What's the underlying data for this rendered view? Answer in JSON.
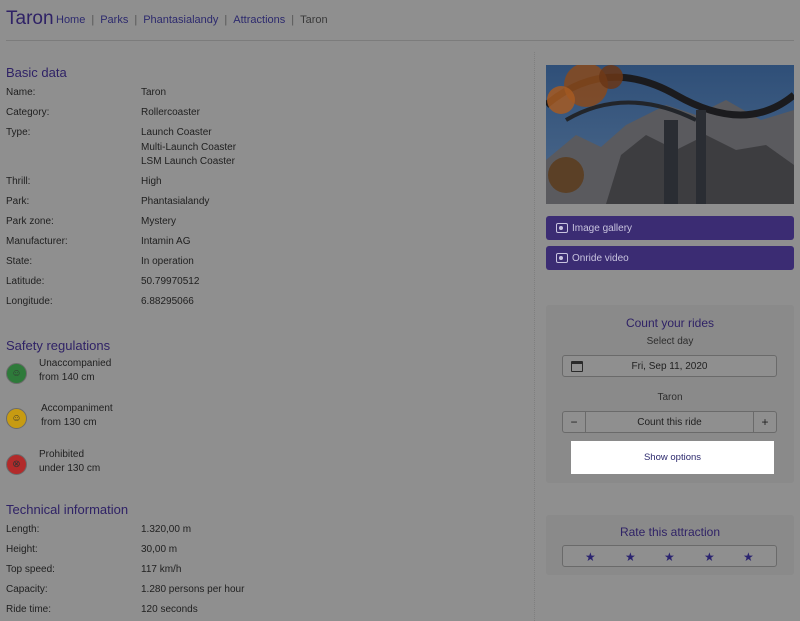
{
  "page": {
    "title": "Taron",
    "breadcrumbs": [
      "Home",
      "Parks",
      "Phantasialandy",
      "Attractions",
      "Taron"
    ]
  },
  "basic": {
    "title": "Basic data",
    "rows": [
      {
        "label": "Name:",
        "values": [
          "Taron"
        ]
      },
      {
        "label": "Category:",
        "values": [
          "Rollercoaster"
        ]
      },
      {
        "label": "Type:",
        "values": [
          "Launch Coaster",
          "Multi-Launch Coaster",
          "LSM Launch Coaster"
        ]
      },
      {
        "label": "Thrill:",
        "values": [
          "High"
        ]
      },
      {
        "label": "Park:",
        "values": [
          "Phantasialandy"
        ]
      },
      {
        "label": "Park zone:",
        "values": [
          "Mystery"
        ]
      },
      {
        "label": "Manufacturer:",
        "values": [
          "Intamin AG"
        ]
      },
      {
        "label": "State:",
        "values": [
          "In operation"
        ]
      },
      {
        "label": "Latitude:",
        "values": [
          "50.79970512"
        ]
      },
      {
        "label": "Longitude:",
        "values": [
          "6.88295066"
        ]
      }
    ]
  },
  "safety": {
    "title": "Safety regulations",
    "items": [
      {
        "line1": "Unaccompanied",
        "line2": "from 140 cm",
        "color": "#2e7a3a",
        "icon": "person-icon"
      },
      {
        "line1": "Accompaniment",
        "line2": "from 130 cm",
        "color": "#c79b12",
        "icon": "group-icon"
      },
      {
        "line1": "Prohibited",
        "line2": "under 130 cm",
        "color": "#b22a2a",
        "icon": "prohibited-icon"
      }
    ]
  },
  "tech": {
    "title": "Technical information",
    "rows": [
      {
        "label": "Length:",
        "value": "1.320,00 m"
      },
      {
        "label": "Height:",
        "value": "30,00 m"
      },
      {
        "label": "Top speed:",
        "value": "117 km/h"
      },
      {
        "label": "Capacity:",
        "value": "1.280 persons per hour"
      },
      {
        "label": "Ride time:",
        "value": "120 seconds"
      }
    ]
  },
  "sidebar": {
    "gallery_label": "Image gallery",
    "video_label": "Onride video",
    "count": {
      "title": "Count your rides",
      "select_day_label": "Select day",
      "date_value": "Fri, Sep 11, 2020",
      "ride_name": "Taron",
      "minus": "−",
      "count_label": "Count this ride",
      "plus": "+",
      "show_options": "Show options"
    },
    "rate": {
      "title": "Rate this attraction",
      "stars": [
        "★",
        "★",
        "★",
        "★",
        "★"
      ]
    }
  },
  "colors": {
    "accent": "#3b2c73",
    "title": "#2f2266",
    "overlay_bg": "#8f8f8f"
  }
}
